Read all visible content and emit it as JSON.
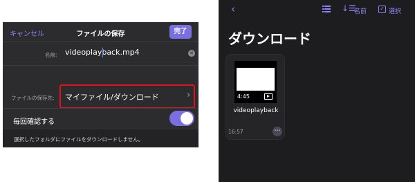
{
  "save_dialog": {
    "cancel_label": "キャンセル",
    "title": "ファイルの保存",
    "done_label": "完了",
    "name_label": "名前:",
    "name_value": "videoplayback.mp4",
    "location_label": "ファイルの保存先:",
    "location_value": "マイファイル/ダウンロード",
    "confirm_label": "毎回確認する",
    "confirm_enabled": true,
    "footer_text": "選択したフォルダにファイルをダウンロードしません。",
    "accent_color": "#7a6fe0",
    "highlight_color": "#e0141c"
  },
  "downloads": {
    "title": "ダウンロード",
    "toolbar": {
      "back_icon": "chevron-left-icon",
      "list_icon": "list-view-icon",
      "sort_icon": "sort-icon",
      "sort_label": "名前",
      "select_icon": "checkbox-icon",
      "select_label": "選択"
    },
    "files": [
      {
        "name": "videoplayback",
        "duration": "4:45",
        "time": "16:57"
      }
    ]
  }
}
